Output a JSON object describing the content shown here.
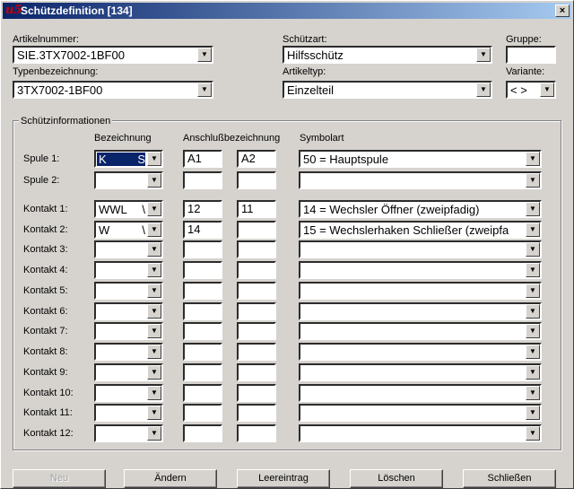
{
  "window": {
    "title": "Schützdefinition [134]",
    "close": "×"
  },
  "header": {
    "artikelnummer_label": "Artikelnummer:",
    "artikelnummer_value": "SIE.3TX7002-1BF00",
    "typenbezeichnung_label": "Typenbezeichnung:",
    "typenbezeichnung_value": "3TX7002-1BF00",
    "schuetzart_label": "Schützart:",
    "schuetzart_value": "Hilfsschütz",
    "artikeltyp_label": "Artikeltyp:",
    "artikeltyp_value": "Einzelteil",
    "gruppe_label": "Gruppe:",
    "gruppe_value": "",
    "variante_label": "Variante:",
    "variante_value": "< >"
  },
  "group": {
    "title": "Schützinformationen",
    "col_bezeichnung": "Bezeichnung",
    "col_anschluss": "Anschlußbezeichnung",
    "col_symbolart": "Symbolart"
  },
  "rows": [
    {
      "label": "Spule 1:",
      "bez": "K",
      "bez_tail": "S",
      "a1": "A1",
      "a2": "A2",
      "sym": "50 = Hauptspule"
    },
    {
      "label": "Spule 2:",
      "bez": "",
      "bez_tail": "",
      "a1": "",
      "a2": "",
      "sym": ""
    },
    {
      "label": "Kontakt 1:",
      "bez": "WWL",
      "bez_tail": "\\",
      "a1": "12",
      "a2": "11",
      "sym": "14 = Wechsler Öffner (zweipfadig)"
    },
    {
      "label": "Kontakt 2:",
      "bez": "W",
      "bez_tail": "\\",
      "a1": "14",
      "a2": "",
      "sym": "15 = Wechslerhaken Schließer (zweipfa"
    },
    {
      "label": "Kontakt 3:",
      "bez": "",
      "bez_tail": "",
      "a1": "",
      "a2": "",
      "sym": ""
    },
    {
      "label": "Kontakt 4:",
      "bez": "",
      "bez_tail": "",
      "a1": "",
      "a2": "",
      "sym": ""
    },
    {
      "label": "Kontakt 5:",
      "bez": "",
      "bez_tail": "",
      "a1": "",
      "a2": "",
      "sym": ""
    },
    {
      "label": "Kontakt 6:",
      "bez": "",
      "bez_tail": "",
      "a1": "",
      "a2": "",
      "sym": ""
    },
    {
      "label": "Kontakt 7:",
      "bez": "",
      "bez_tail": "",
      "a1": "",
      "a2": "",
      "sym": ""
    },
    {
      "label": "Kontakt 8:",
      "bez": "",
      "bez_tail": "",
      "a1": "",
      "a2": "",
      "sym": ""
    },
    {
      "label": "Kontakt 9:",
      "bez": "",
      "bez_tail": "",
      "a1": "",
      "a2": "",
      "sym": ""
    },
    {
      "label": "Kontakt 10:",
      "bez": "",
      "bez_tail": "",
      "a1": "",
      "a2": "",
      "sym": ""
    },
    {
      "label": "Kontakt 11:",
      "bez": "",
      "bez_tail": "",
      "a1": "",
      "a2": "",
      "sym": ""
    },
    {
      "label": "Kontakt 12:",
      "bez": "",
      "bez_tail": "",
      "a1": "",
      "a2": "",
      "sym": ""
    }
  ],
  "buttons": {
    "neu": "Neu",
    "aendern": "Ändern",
    "leereintrag": "Leereintrag",
    "loeschen": "Löschen",
    "schliessen": "Schließen"
  }
}
